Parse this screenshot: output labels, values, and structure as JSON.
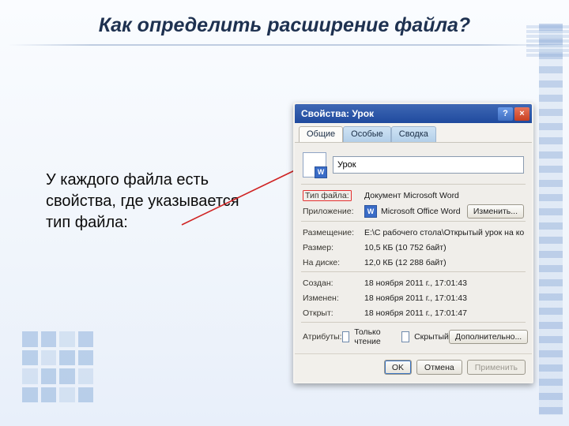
{
  "slide": {
    "title": "Как определить расширение файла?",
    "body": "У каждого файла есть свойства, где указывается тип файла:"
  },
  "dialog": {
    "title": "Свойства: Урок",
    "help": "?",
    "close": "×",
    "tabs": {
      "general": "Общие",
      "special": "Особые",
      "summary": "Сводка"
    },
    "filename": "Урок",
    "labels": {
      "filetype": "Тип файла:",
      "app": "Приложение:",
      "location": "Размещение:",
      "size": "Размер:",
      "ondisk": "На диске:",
      "created": "Создан:",
      "modified": "Изменен:",
      "opened": "Открыт:",
      "attributes": "Атрибуты:",
      "readonly": "Только чтение",
      "hidden": "Скрытый"
    },
    "values": {
      "filetype": "Документ Microsoft Word",
      "app": "Microsoft Office Word",
      "location": "E:\\С рабочего стола\\Открытый урок на конку",
      "size": "10,5 КБ (10 752 байт)",
      "ondisk": "12,0 КБ (12 288 байт)",
      "created": "18 ноября 2011 г., 17:01:43",
      "modified": "18 ноября 2011 г., 17:01:43",
      "opened": "18 ноября 2011 г., 17:01:47"
    },
    "buttons": {
      "change": "Изменить...",
      "advanced": "Дополнительно...",
      "ok": "OK",
      "cancel": "Отмена",
      "apply": "Применить"
    }
  }
}
